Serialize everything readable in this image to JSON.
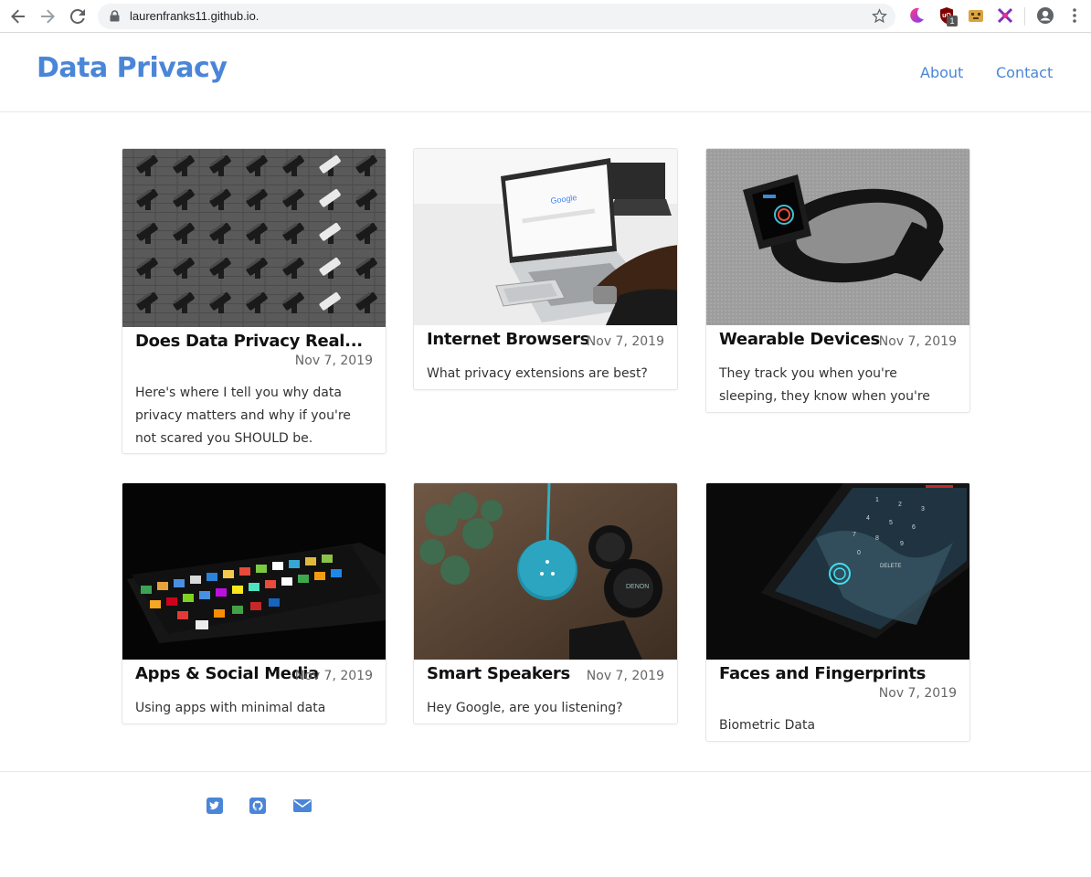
{
  "browser": {
    "url": "laurenfranks11.github.io.",
    "extension_badge": "1"
  },
  "site": {
    "title": "Data Privacy",
    "nav": {
      "about": "About",
      "contact": "Contact"
    }
  },
  "posts": [
    {
      "title": "Does Data Privacy Real...",
      "date": "Nov 7, 2019",
      "excerpt": "Here's where I tell you why data privacy matters and why if you're not scared you SHOULD be."
    },
    {
      "title": "Internet Browsers",
      "date": "Nov 7, 2019",
      "excerpt": "What privacy extensions are best?"
    },
    {
      "title": "Wearable Devices",
      "date": "Nov 7, 2019",
      "excerpt": "They track you when you're sleeping, they know when you're awake..."
    },
    {
      "title": "Apps & Social Media",
      "date": "Nov 7, 2019",
      "excerpt": "Using apps with minimal data leakage."
    },
    {
      "title": "Smart Speakers",
      "date": "Nov 7, 2019",
      "excerpt": "Hey Google, are you listening?"
    },
    {
      "title": "Faces and Fingerprints",
      "date": "Nov 7, 2019",
      "excerpt": "Biometric Data"
    }
  ],
  "footer": {
    "icons": [
      "twitter-icon",
      "github-icon",
      "email-icon"
    ]
  },
  "colors": {
    "accent": "#4a86d8",
    "text": "#111111",
    "muted": "#666666"
  }
}
